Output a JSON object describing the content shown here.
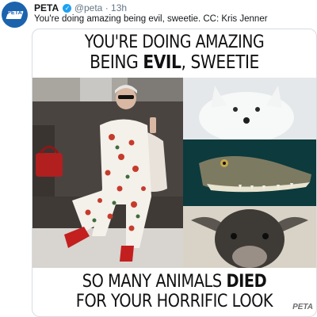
{
  "tweet": {
    "author_name": "PETA",
    "handle": "@peta",
    "separator": "·",
    "time": "13h",
    "text": "You're doing amazing being evil, sweetie. CC: Kris Jenner",
    "avatar_text": "PETA",
    "verified_mark": "✓"
  },
  "image": {
    "line1": "YOU'RE DOING AMAZING",
    "line2_pre": "BEING ",
    "line2_bold": "EVIL",
    "line2_post": ", SWEETIE",
    "line3_pre": "SO MANY ANIMALS ",
    "line3_bold": "DIED",
    "line4": "FOR YOUR HORRIFIC LOOK",
    "watermark": "PETA"
  },
  "colors": {
    "avatar_bg": "#1b63ad",
    "verified": "#1da1f2",
    "secondary_text": "#657786"
  }
}
